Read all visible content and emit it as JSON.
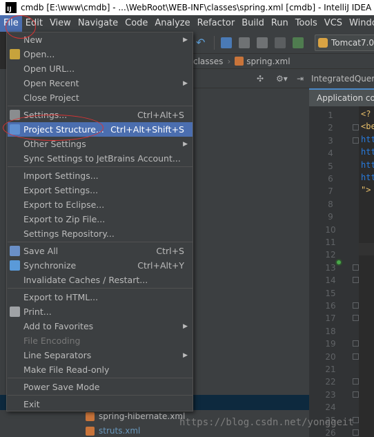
{
  "window": {
    "logo_text": "IJ",
    "title": "cmdb [E:\\www\\cmdb] - ...\\WebRoot\\WEB-INF\\classes\\spring.xml [cmdb] - IntelliJ IDEA"
  },
  "menubar": [
    "File",
    "Edit",
    "View",
    "Navigate",
    "Code",
    "Analyze",
    "Refactor",
    "Build",
    "Run",
    "Tools",
    "VCS",
    "Window"
  ],
  "toolbar": {
    "run_config": "Tomcat7.0"
  },
  "breadcrumb": [
    "classes",
    "spring.xml"
  ],
  "editor": {
    "tab": "IntegratedQuery",
    "context": "Application co",
    "line_numbers": [
      "1",
      "2",
      "3",
      "4",
      "5",
      "6",
      "7",
      "8",
      "9",
      "10",
      "11",
      "12",
      "13",
      "14",
      "15",
      "16",
      "17",
      "18",
      "19",
      "20",
      "21",
      "22",
      "23",
      "24",
      "25",
      "26"
    ],
    "code_lines": [
      "<?",
      "<be",
      "htt",
      "htt",
      "htt",
      "htt",
      "\">"
    ]
  },
  "project_tree": [
    "spring-hibernate.xml",
    "struts.xml"
  ],
  "file_menu": {
    "items": [
      {
        "label": "New",
        "shortcut": "",
        "submenu": true,
        "icon": ""
      },
      {
        "label": "Open...",
        "shortcut": "",
        "submenu": false,
        "icon": "folder-icon"
      },
      {
        "label": "Open URL...",
        "shortcut": "",
        "submenu": false,
        "icon": ""
      },
      {
        "label": "Open Recent",
        "shortcut": "",
        "submenu": true,
        "icon": ""
      },
      {
        "label": "Close Project",
        "shortcut": "",
        "submenu": false,
        "icon": ""
      },
      {
        "label": "Settings...",
        "shortcut": "Ctrl+Alt+S",
        "submenu": false,
        "icon": "wrench-icon"
      },
      {
        "label": "Project Structure...",
        "shortcut": "Ctrl+Alt+Shift+S",
        "submenu": false,
        "icon": "project-structure-icon"
      },
      {
        "label": "Other Settings",
        "shortcut": "",
        "submenu": true,
        "icon": ""
      },
      {
        "label": "Sync Settings to JetBrains Account...",
        "shortcut": "",
        "submenu": false,
        "icon": ""
      },
      {
        "label": "Import Settings...",
        "shortcut": "",
        "submenu": false,
        "icon": ""
      },
      {
        "label": "Export Settings...",
        "shortcut": "",
        "submenu": false,
        "icon": ""
      },
      {
        "label": "Export to Eclipse...",
        "shortcut": "",
        "submenu": false,
        "icon": ""
      },
      {
        "label": "Export to Zip File...",
        "shortcut": "",
        "submenu": false,
        "icon": ""
      },
      {
        "label": "Settings Repository...",
        "shortcut": "",
        "submenu": false,
        "icon": ""
      },
      {
        "label": "Save All",
        "shortcut": "Ctrl+S",
        "submenu": false,
        "icon": "save-icon"
      },
      {
        "label": "Synchronize",
        "shortcut": "Ctrl+Alt+Y",
        "submenu": false,
        "icon": "sync-icon"
      },
      {
        "label": "Invalidate Caches / Restart...",
        "shortcut": "",
        "submenu": false,
        "icon": ""
      },
      {
        "label": "Export to HTML...",
        "shortcut": "",
        "submenu": false,
        "icon": ""
      },
      {
        "label": "Print...",
        "shortcut": "",
        "submenu": false,
        "icon": "print-icon"
      },
      {
        "label": "Add to Favorites",
        "shortcut": "",
        "submenu": true,
        "icon": ""
      },
      {
        "label": "File Encoding",
        "shortcut": "",
        "submenu": false,
        "icon": "",
        "disabled": true
      },
      {
        "label": "Line Separators",
        "shortcut": "",
        "submenu": true,
        "icon": ""
      },
      {
        "label": "Make File Read-only",
        "shortcut": "",
        "submenu": false,
        "icon": ""
      },
      {
        "label": "Power Save Mode",
        "shortcut": "",
        "submenu": false,
        "icon": ""
      },
      {
        "label": "Exit",
        "shortcut": "",
        "submenu": false,
        "icon": ""
      }
    ]
  },
  "watermark": "https://blog.csdn.net/yonggeit",
  "colors": {
    "menu_bg": "#3c3f41",
    "highlight": "#4b6eaf",
    "editor_bg": "#2b2b2b",
    "annotation": "#dd3333"
  }
}
